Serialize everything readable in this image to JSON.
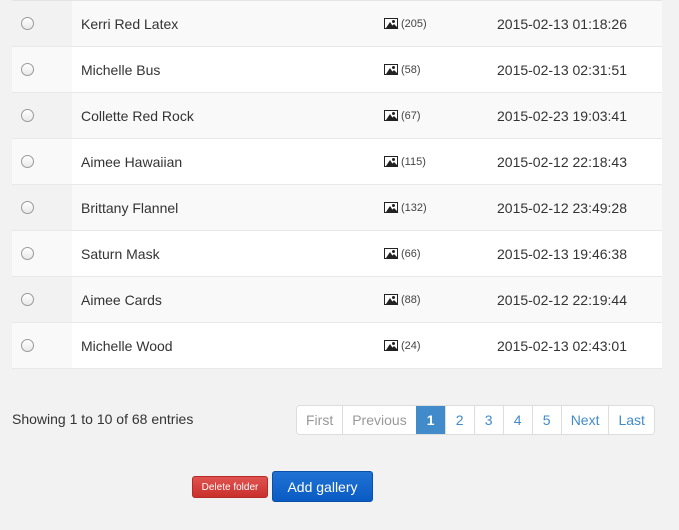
{
  "rows": [
    {
      "name": "Kerri Red Latex",
      "count": "(205)",
      "date": "2015-02-13 01:18:26"
    },
    {
      "name": "Michelle Bus",
      "count": "(58)",
      "date": "2015-02-13 02:31:51"
    },
    {
      "name": "Collette Red Rock",
      "count": "(67)",
      "date": "2015-02-23 19:03:41"
    },
    {
      "name": "Aimee Hawaiian",
      "count": "(115)",
      "date": "2015-02-12 22:18:43"
    },
    {
      "name": "Brittany Flannel",
      "count": "(132)",
      "date": "2015-02-12 23:49:28"
    },
    {
      "name": "Saturn Mask",
      "count": "(66)",
      "date": "2015-02-13 19:46:38"
    },
    {
      "name": "Aimee Cards",
      "count": "(88)",
      "date": "2015-02-12 22:19:44"
    },
    {
      "name": "Michelle Wood",
      "count": "(24)",
      "date": "2015-02-13 02:43:01"
    }
  ],
  "footer": {
    "info": "Showing 1 to 10 of 68 entries"
  },
  "pagination": {
    "first": "First",
    "previous": "Previous",
    "pages": [
      "1",
      "2",
      "3",
      "4",
      "5"
    ],
    "active_page": "1",
    "next": "Next",
    "last": "Last"
  },
  "actions": {
    "delete_label": "Delete folder",
    "add_label": "Add gallery"
  },
  "colors": {
    "accent": "#428bca",
    "delete": "#d9534f",
    "add": "#1565d0"
  },
  "icons": {
    "photo_count": "image-icon"
  }
}
